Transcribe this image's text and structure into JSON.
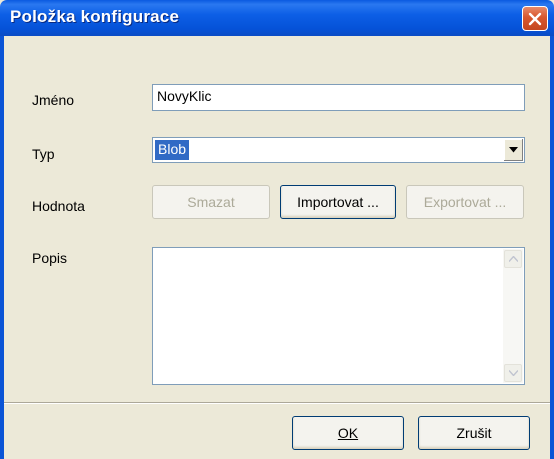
{
  "window": {
    "title": "Položka konfigurace"
  },
  "form": {
    "name_label": "Jméno",
    "name_value": "NovyKlic",
    "type_label": "Typ",
    "type_value": "Blob",
    "value_label": "Hodnota",
    "description_label": "Popis",
    "description_value": ""
  },
  "value_buttons": {
    "delete_label": "Smazat",
    "import_label": "Importovat ...",
    "export_label": "Exportovat ..."
  },
  "footer": {
    "ok_label": "OK",
    "cancel_label": "Zrušit"
  },
  "colors": {
    "title_bar": "#0a54d6",
    "close_button": "#d8572e",
    "selection": "#316ac5",
    "dialog_bg": "#ece9d8"
  },
  "icons": {
    "close": "close-icon",
    "dropdown": "chevron-down-icon",
    "scroll_up": "arrow-up-icon",
    "scroll_down": "arrow-down-icon"
  }
}
